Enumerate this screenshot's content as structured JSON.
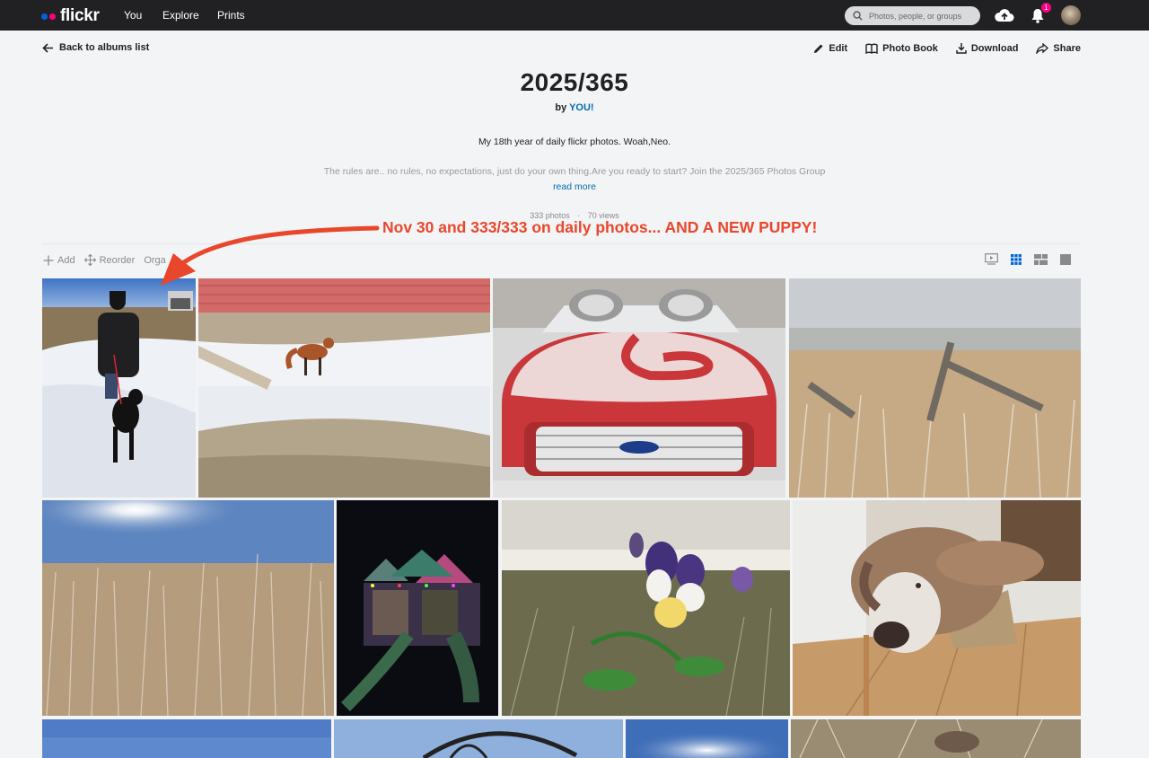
{
  "topbar": {
    "logo_text": "flickr",
    "nav": [
      "You",
      "Explore",
      "Prints"
    ],
    "search_placeholder": "Photos, people, or groups",
    "notification_count": "1",
    "colors": {
      "bg": "#212124",
      "logo_blue": "#0063dc",
      "logo_pink": "#ff0084"
    }
  },
  "album": {
    "back_label": "Back to albums list",
    "actions": [
      "Edit",
      "Photo Book",
      "Download",
      "Share"
    ],
    "title": "2025/365",
    "by_prefix": "by",
    "owner": "YOU!",
    "description_line1": "My 18th year of daily flickr photos. Woah,Neo.",
    "description_line2": "The rules are.. no rules, no expectations, just do your own thing.Are you ready to start? Join the 2025/365 Photos Group",
    "read_more": "read more",
    "photo_count": "333 photos",
    "separator": "·",
    "views": "70 views"
  },
  "annotation": {
    "text": "Nov 30 and 333/333 on daily photos... AND A NEW PUPPY!",
    "color": "#e8472b"
  },
  "toolbar": {
    "add": "Add",
    "reorder": "Reorder",
    "organize": "Orga",
    "view_modes": [
      "slideshow-icon",
      "justified-grid-icon",
      "mosaic-icon",
      "single-icon"
    ],
    "active_view": "justified-grid-icon"
  },
  "photos": [
    {
      "name": "photo-woman-with-puppy-snow"
    },
    {
      "name": "photo-fox-in-snow"
    },
    {
      "name": "photo-frosted-red-ford-truck"
    },
    {
      "name": "photo-frosted-field-fence"
    },
    {
      "name": "photo-sun-over-frosted-grass"
    },
    {
      "name": "photo-playground-night-lights"
    },
    {
      "name": "photo-pansy-flower"
    },
    {
      "name": "photo-sleeping-old-dog"
    },
    {
      "name": "photo-blue-sky"
    },
    {
      "name": "photo-metal-arch-sky"
    },
    {
      "name": "photo-sun-flare-sky"
    },
    {
      "name": "photo-dry-grass-closeup"
    }
  ]
}
